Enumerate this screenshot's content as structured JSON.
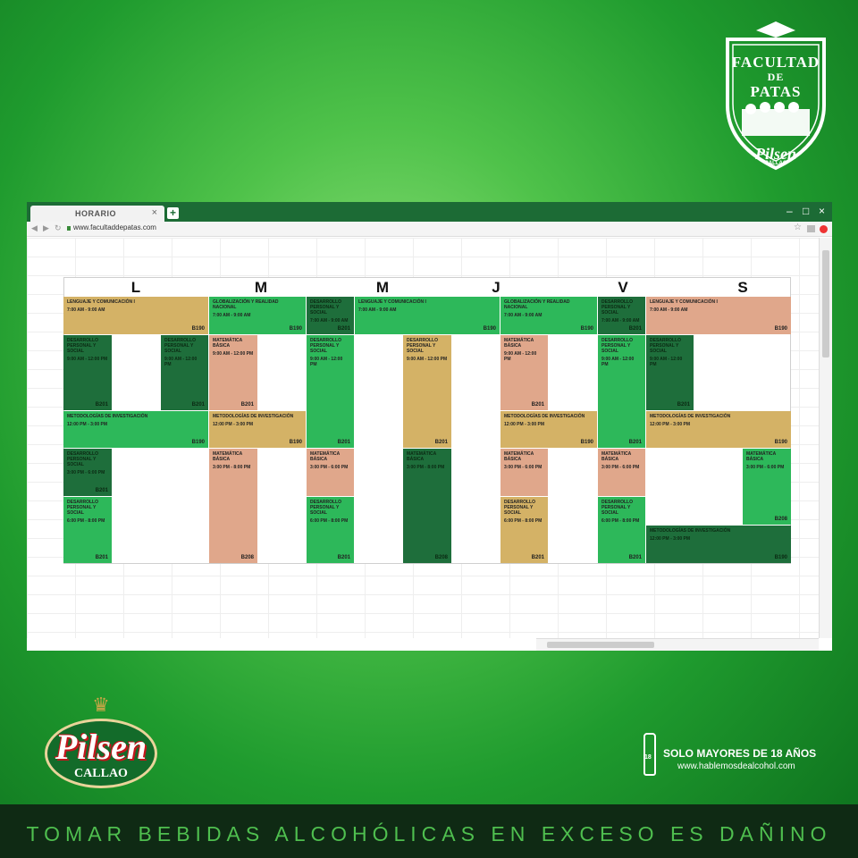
{
  "crest": {
    "line1": "FACULTAD",
    "line2": "DE",
    "line3": "PATAS",
    "brand": "Pilsen",
    "sub": "CALLAO"
  },
  "browser": {
    "tab_title": "HORARIO",
    "tab_close": "×",
    "new_tab": "+",
    "url": "www.facultaddepatas.com",
    "min": "–",
    "max": "□",
    "close": "×"
  },
  "days": [
    "L",
    "M",
    "M",
    "J",
    "V",
    "S"
  ],
  "cells": [
    {
      "label": "LENGUAJE Y COMUNICACIÓN I",
      "time": "7:00 AM - 9:00 AM",
      "room": "B190"
    },
    {
      "label": "GLOBALIZACIÓN Y REALIDAD NACIONAL",
      "time": "7:00 AM - 9:00 AM",
      "room": "B190"
    },
    {
      "label": "DESARROLLO PERSONAL Y SOCIAL",
      "time": "7:00 AM - 9:00 AM",
      "room": "B201"
    },
    {
      "label": "LENGUAJE Y COMUNICACIÓN I",
      "time": "7:00 AM - 9:00 AM",
      "room": "B190"
    },
    {
      "label": "GLOBALIZACIÓN Y REALIDAD NACIONAL",
      "time": "7:00 AM - 9:00 AM",
      "room": "B190"
    },
    {
      "label": "DESARROLLO PERSONAL Y SOCIAL",
      "time": "7:00 AM - 9:00 AM",
      "room": "B201"
    },
    {
      "label": "LENGUAJE Y COMUNICACIÓN I",
      "time": "7:00 AM - 9:00 AM",
      "room": "B190"
    },
    {
      "label": "DESARROLLO PERSONAL Y SOCIAL",
      "time": "9:00 AM - 12:00 PM",
      "room": "B201"
    },
    {
      "label": "DESARROLLO PERSONAL Y SOCIAL",
      "time": "9:00 AM - 12:00 PM",
      "room": "B201"
    },
    {
      "label": "MATEMÁTICA BÁSICA",
      "time": "9:00 AM - 12:00 PM",
      "room": "B201"
    },
    {
      "label": "DESARROLLO PERSONAL Y SOCIAL",
      "time": "9:00 AM - 12:00 PM",
      "room": "B201"
    },
    {
      "label": "DESARROLLO PERSONAL Y SOCIAL",
      "time": "9:00 AM - 12:00 PM",
      "room": "B201"
    },
    {
      "label": "MATEMÁTICA BÁSICA",
      "time": "9:00 AM - 12:00 PM",
      "room": "B201"
    },
    {
      "label": "DESARROLLO PERSONAL Y SOCIAL",
      "time": "9:00 AM - 12:00 PM",
      "room": "B201"
    },
    {
      "label": "DESARROLLO PERSONAL Y SOCIAL",
      "time": "9:00 AM - 12:00 PM",
      "room": "B201"
    },
    {
      "label": "METODOLOGÍAS DE INVESTIGACIÓN",
      "time": "12:00 PM - 3:00 PM",
      "room": "B190"
    },
    {
      "label": "METODOLOGÍAS DE INVESTIGACIÓN",
      "time": "12:00 PM - 3:00 PM",
      "room": "B190"
    },
    {
      "label": "METODOLOGÍAS DE INVESTIGACIÓN",
      "time": "12:00 PM - 3:00 PM",
      "room": "B190"
    },
    {
      "label": "METODOLOGÍAS DE INVESTIGACIÓN",
      "time": "12:00 PM - 3:00 PM",
      "room": "B190"
    },
    {
      "label": "DESARROLLO PERSONAL Y SOCIAL",
      "time": "3:00 PM - 6:00 PM",
      "room": "B201"
    },
    {
      "label": "MATEMÁTICA BÁSICA",
      "time": "3:00 PM - 8:00 PM",
      "room": "B208"
    },
    {
      "label": "MATEMÁTICA BÁSICA",
      "time": "3:00 PM - 6:00 PM",
      "room": ""
    },
    {
      "label": "MATEMÁTICA BÁSICA",
      "time": "3:00 PM - 8:00 PM",
      "room": "B208"
    },
    {
      "label": "MATEMÁTICA BÁSICA",
      "time": "3:00 PM - 6:00 PM",
      "room": ""
    },
    {
      "label": "MATEMÁTICA BÁSICA",
      "time": "3:00 PM - 6:00 PM",
      "room": ""
    },
    {
      "label": "MATEMÁTICA BÁSICA",
      "time": "3:00 PM - 6:00 PM",
      "room": "B208"
    },
    {
      "label": "DESARROLLO PERSONAL Y SOCIAL",
      "time": "6:00 PM - 8:00 PM",
      "room": "B201"
    },
    {
      "label": "DESARROLLO PERSONAL Y SOCIAL",
      "time": "6:00 PM - 8:00 PM",
      "room": "B201"
    },
    {
      "label": "DESARROLLO PERSONAL Y SOCIAL",
      "time": "6:00 PM - 8:00 PM",
      "room": "B201"
    },
    {
      "label": "DESARROLLO PERSONAL Y SOCIAL",
      "time": "6:00 PM - 8:00 PM",
      "room": "B201"
    },
    {
      "label": "METODOLOGÍAS DE INVESTIGACIÓN",
      "time": "12:00 PM - 3:00 PM",
      "room": "B190"
    }
  ],
  "brand": {
    "name": "Pilsen",
    "sub": "CALLAO",
    "age": "18",
    "legal_1": "SOLO MAYORES DE 18 AÑOS",
    "legal_2": "www.hablemosdealcohol.com",
    "footer": "TOMAR BEBIDAS ALCOHÓLICAS EN EXCESO ES DAÑINO"
  }
}
